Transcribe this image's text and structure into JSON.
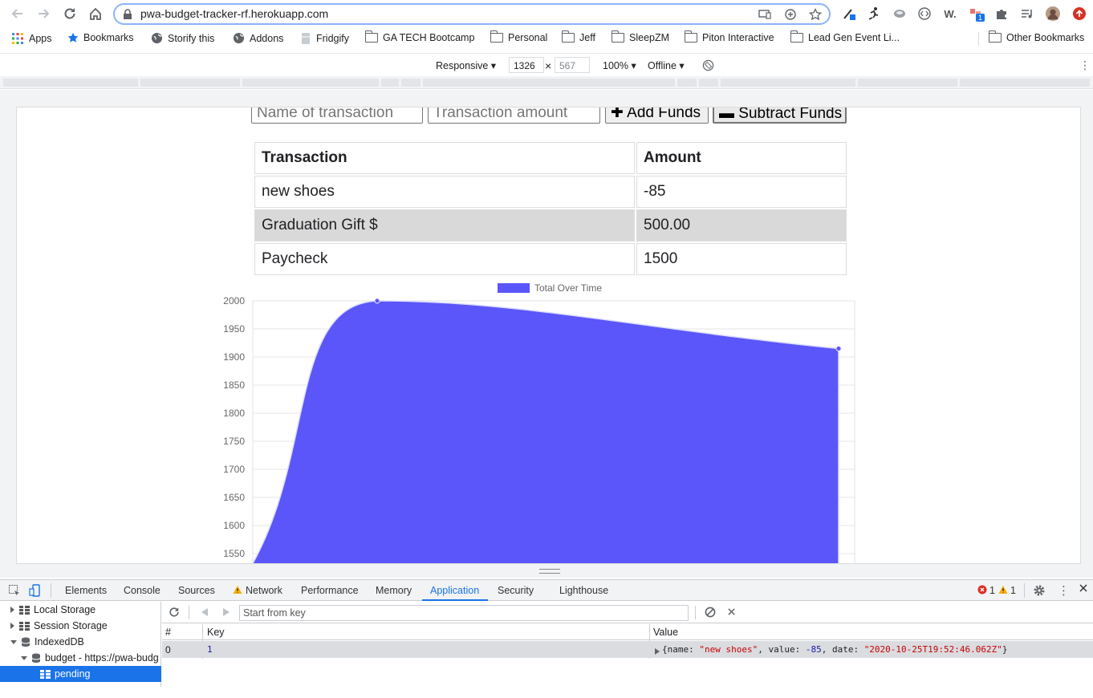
{
  "browser": {
    "url": "pwa-budget-tracker-rf.herokuapp.com",
    "bookmarks": [
      "Apps",
      "Bookmarks",
      "Storify this",
      "Addons",
      "Fridgify",
      "GA TECH Bootcamp",
      "Personal",
      "Jeff",
      "SleepZM",
      "Piton Interactive",
      "Lead Gen Event Li..."
    ],
    "other_bookmarks": "Other Bookmarks",
    "ext_badge": "1"
  },
  "device_toolbar": {
    "mode": "Responsive ▾",
    "width": "1326",
    "times": "×",
    "height": "567",
    "zoom": "100% ▾",
    "network": "Offline ▾"
  },
  "app": {
    "name_placeholder": "Name of transaction",
    "amount_placeholder": "Transaction amount",
    "add_label": "Add Funds",
    "subtract_label": "Subtract Funds",
    "table": {
      "headers": [
        "Transaction",
        "Amount"
      ],
      "rows": [
        {
          "name": "new shoes",
          "amount": "-85"
        },
        {
          "name": "Graduation Gift $",
          "amount": "500.00"
        },
        {
          "name": "Paycheck",
          "amount": "1500"
        }
      ]
    }
  },
  "chart_data": {
    "type": "area",
    "series": [
      {
        "name": "Total Over Time",
        "color": "#5a56f9",
        "values": [
          1500,
          2000,
          1915
        ]
      }
    ],
    "y_ticks": [
      1550,
      1600,
      1650,
      1700,
      1750,
      1800,
      1850,
      1900,
      1950,
      2000
    ],
    "ylim": [
      1550,
      2000
    ],
    "grid": true,
    "legend": "top-center"
  },
  "devtools": {
    "tabs": [
      "Elements",
      "Console",
      "Sources",
      "Network",
      "Performance",
      "Memory",
      "Application",
      "Security",
      "Lighthouse"
    ],
    "active_tab": "Application",
    "errors": "1",
    "warnings": "1",
    "sidebar": {
      "local_storage": "Local Storage",
      "session_storage": "Session Storage",
      "indexeddb": "IndexedDB",
      "db": "budget - https://pwa-budg",
      "store": "pending"
    },
    "start_key_placeholder": "Start from key",
    "columns": [
      "#",
      "Key",
      "Value"
    ],
    "row": {
      "index": "0",
      "key": "1",
      "value_prefix": "{name: ",
      "value_name": "\"new shoes\"",
      "value_mid": ", value: ",
      "value_num": "-85",
      "value_mid2": ", date: ",
      "value_date": "\"2020-10-25T19:52:46.062Z\"",
      "value_suffix": "}"
    }
  }
}
